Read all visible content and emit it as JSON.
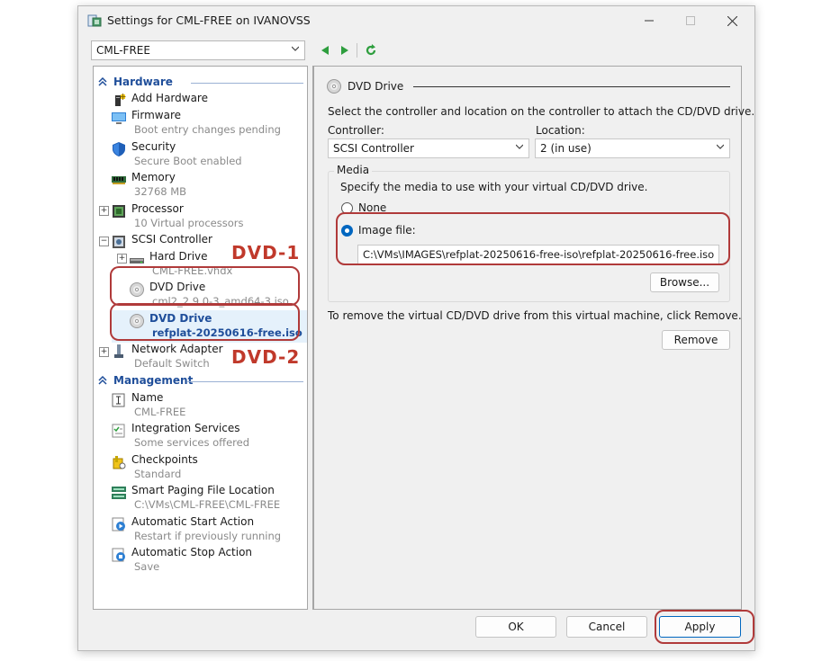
{
  "window": {
    "title": "Settings for CML-FREE on IVANOVSS",
    "controls": [
      "minimize",
      "maximize",
      "close"
    ]
  },
  "vm_selector": {
    "value": "CML-FREE"
  },
  "nav": {
    "back_icon": "back-arrow-icon",
    "forward_icon": "forward-arrow-icon",
    "refresh_icon": "refresh-icon"
  },
  "tree": {
    "hardware_label": "Hardware",
    "management_label": "Management",
    "hardware_items": [
      {
        "name": "Add Hardware",
        "sub": ""
      },
      {
        "name": "Firmware",
        "sub": "Boot entry changes pending"
      },
      {
        "name": "Security",
        "sub": "Secure Boot enabled"
      },
      {
        "name": "Memory",
        "sub": "32768 MB"
      },
      {
        "name": "Processor",
        "sub": "10 Virtual processors"
      },
      {
        "name": "SCSI Controller",
        "sub": ""
      },
      {
        "name": "Hard Drive",
        "sub": "CML-FREE.vhdx"
      },
      {
        "name": "DVD Drive",
        "sub": "cml2_2.9.0-3_amd64-3.iso"
      },
      {
        "name": "DVD Drive",
        "sub": "refplat-20250616-free.iso"
      },
      {
        "name": "Network Adapter",
        "sub": "Default Switch"
      }
    ],
    "management_items": [
      {
        "name": "Name",
        "sub": "CML-FREE"
      },
      {
        "name": "Integration Services",
        "sub": "Some services offered"
      },
      {
        "name": "Checkpoints",
        "sub": "Standard"
      },
      {
        "name": "Smart Paging File Location",
        "sub": "C:\\VMs\\CML-FREE\\CML-FREE"
      },
      {
        "name": "Automatic Start Action",
        "sub": "Restart if previously running"
      },
      {
        "name": "Automatic Stop Action",
        "sub": "Save"
      }
    ]
  },
  "panel": {
    "header": "DVD Drive",
    "intro": "Select the controller and location on the controller to attach the CD/DVD drive.",
    "controller_label": "Controller:",
    "controller_value": "SCSI Controller",
    "location_label": "Location:",
    "location_value": "2 (in use)",
    "media_label": "Media",
    "media_desc": "Specify the media to use with your virtual CD/DVD drive.",
    "none_label": "None",
    "image_label": "Image file:",
    "image_path": "C:\\VMs\\IMAGES\\refplat-20250616-free-iso\\refplat-20250616-free.iso",
    "browse_label": "Browse...",
    "remove_text": "To remove the virtual CD/DVD drive from this virtual machine, click Remove.",
    "remove_label": "Remove",
    "selected_media": "Image file"
  },
  "footer": {
    "ok": "OK",
    "cancel": "Cancel",
    "apply": "Apply"
  },
  "annotations": {
    "dvd1": "DVD-1",
    "dvd2": "DVD-2",
    "color": "#c0392b"
  }
}
